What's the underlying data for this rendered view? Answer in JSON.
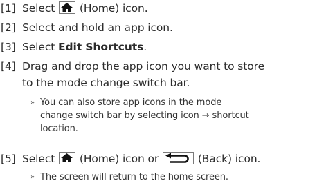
{
  "steps": [
    {
      "num": "[1]",
      "pre": "Select",
      "post": "(Home) icon."
    },
    {
      "num": "[2]",
      "text": "Select and hold an app icon."
    },
    {
      "num": "[3]",
      "pre": "Select ",
      "bold": "Edit Shortcuts",
      "post": "."
    },
    {
      "num": "[4]",
      "line1": "Drag and drop the app icon you want to store",
      "line2": "to the mode change switch bar."
    },
    {
      "num": "[5]",
      "pre": "Select",
      "mid": "(Home) icon or",
      "post": "(Back) icon."
    }
  ],
  "notes": [
    {
      "marker": "»",
      "line1": "You can also store app icons in the mode",
      "line2": "change switch bar by selecting icon → shortcut",
      "line3": "location."
    },
    {
      "marker": "»",
      "line1": "The screen will return to the home screen."
    }
  ],
  "icons": {
    "home": "home-icon",
    "back": "back-icon"
  },
  "colors": {
    "text": "#2b2b2b",
    "icon_border": "#7a7a7a",
    "icon_fill": "#111111"
  }
}
